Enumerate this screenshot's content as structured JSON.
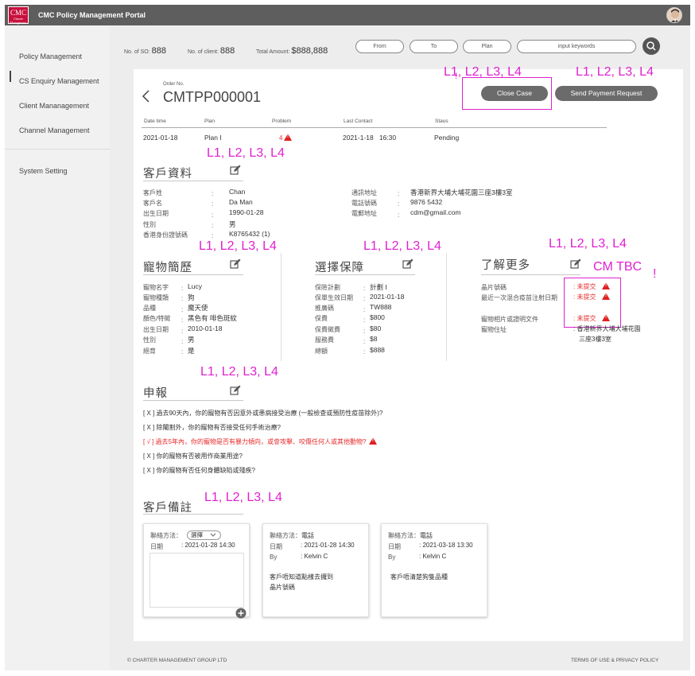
{
  "app": {
    "title": "CMC Policy Management Portal",
    "logo_text": "CMC",
    "logo_sub": "Charter Management"
  },
  "sidebar": {
    "items": [
      {
        "label": "Policy Management"
      },
      {
        "label": "CS Enquiry Management"
      },
      {
        "label": "Client Mananagement"
      },
      {
        "label": "Channel Management"
      },
      {
        "label": "System Setting"
      }
    ]
  },
  "stats": {
    "so_label": "No. of SO:",
    "so_value": "888",
    "client_label": "No. of client:",
    "client_value": "888",
    "amount_label": "Total Amount:",
    "amount_value": "$888,888"
  },
  "filters": {
    "from": "From",
    "to": "To",
    "plan": "Plan",
    "search_placeholder": "input keywords"
  },
  "order": {
    "label": "Order No.",
    "number": "CMTPP000001"
  },
  "buttons": {
    "close_case": "Close Case",
    "send_payment": "Send Payment Request"
  },
  "annotations": {
    "levels": "L1, L2, L3, L4",
    "cm_tbc": "CM TBC",
    "bang": "!"
  },
  "summary": {
    "headers": [
      "Date time",
      "Plan",
      "Problem",
      "Last Contact",
      "Staus"
    ],
    "row": {
      "date": "2021-01-18",
      "plan": "Plan I",
      "problem": "4",
      "last_contact": "2021-1-18   16:30",
      "status": "Pending"
    }
  },
  "client": {
    "title": "客戶資料",
    "left": [
      {
        "label": "客戶姓",
        "value": "Chan"
      },
      {
        "label": "客戶名",
        "value": "Da Man"
      },
      {
        "label": "出生日期",
        "value": "1990-01-28"
      },
      {
        "label": "性別",
        "value": "男"
      },
      {
        "label": "香港身份證號碼",
        "value": "K8765432 (1)"
      }
    ],
    "right": [
      {
        "label": "通訊地址",
        "value": "香港新界大埔大埔花園三座3樓3室"
      },
      {
        "label": "電話號碼",
        "value": "9876 5432"
      },
      {
        "label": "電郵地址",
        "value": "cdm@gmail.com"
      }
    ]
  },
  "pet": {
    "title": "寵物簡歷",
    "rows": [
      {
        "label": "寵物名字",
        "value": "Lucy"
      },
      {
        "label": "寵物種類",
        "value": "狗"
      },
      {
        "label": "品種",
        "value": "魔天使"
      },
      {
        "label": "顏色/特徵",
        "value": "黑色有 啡色斑紋"
      },
      {
        "label": "出生日期",
        "value": "2010-01-18"
      },
      {
        "label": "性別",
        "value": "男"
      },
      {
        "label": "絕育",
        "value": "是"
      }
    ]
  },
  "plan": {
    "title": "選擇保障",
    "rows": [
      {
        "label": "保險計劃",
        "value": "計劃 I"
      },
      {
        "label": "保單生效日期",
        "value": "2021-01-18"
      },
      {
        "label": "推廣碼",
        "value": "TW888"
      },
      {
        "label": "保費",
        "value": "$800"
      },
      {
        "label": "保費徵費",
        "value": "$80"
      },
      {
        "label": "服務費",
        "value": "$8"
      },
      {
        "label": "總額",
        "value": "$888"
      }
    ]
  },
  "more": {
    "title": "了解更多",
    "rows": [
      {
        "label": "晶片號碼",
        "value": "未提交"
      },
      {
        "label": "最近一次混合疫苗注射日期",
        "value": "未提交"
      },
      {
        "label": "寵物相片或證明文件",
        "value": "未提交"
      },
      {
        "label": "寵物住址",
        "value": "香港新界大埔大埔花園",
        "value2": "三座3樓3室"
      }
    ]
  },
  "declaration": {
    "title": "申報",
    "items": [
      {
        "mark": "[ X ]",
        "text": "過去90天內，你的寵物有否因意外或患病接受治療 (一般檢查或預防性疫苗除外)?"
      },
      {
        "mark": "[ X ]",
        "text": "除閹割外，你的寵物有否接受任何手術治療?"
      },
      {
        "mark": "[ √ ]",
        "text": "過去5年內，你的寵物是否有暴力傾向，或會攻擊、咬傷任何人或其他動物?"
      },
      {
        "mark": "[ X ]",
        "text": "你的寵物有否被用作商業用途?"
      },
      {
        "mark": "[ X ]",
        "text": "你的寵物有否任何身體缺陷或殘疾?"
      }
    ]
  },
  "remarks": {
    "title": "客戶備註",
    "notes": [
      {
        "method_label": "聯絡方法：",
        "method": "選擇",
        "date_label": "日期",
        "date": "2021-01-28 14:30"
      },
      {
        "method_label": "聯絡方法：",
        "method": "電話",
        "date_label": "日期",
        "date": "2021-01-28 14:30",
        "by_label": "By",
        "by": "Kelvin C",
        "content": "客戶唔知道點樣去攞到",
        "content2": "晶片號碼"
      },
      {
        "method_label": "聯絡方法：",
        "method": "電話",
        "date_label": "日期",
        "date": "2021-03-18 13:30",
        "by_label": "By",
        "by": "Kelvin C",
        "content": "客戶唔清楚狗隻品種"
      }
    ]
  },
  "footer": {
    "copyright": "© CHARTER MANAGEMENT GROUP LTD",
    "terms": "TERMS OF USE & PRIVACY POLICY"
  },
  "colors": {
    "topbar": "#5e5e5e",
    "brand": "#c8103c",
    "annotation": "#e020d0",
    "alert": "#e02020"
  }
}
